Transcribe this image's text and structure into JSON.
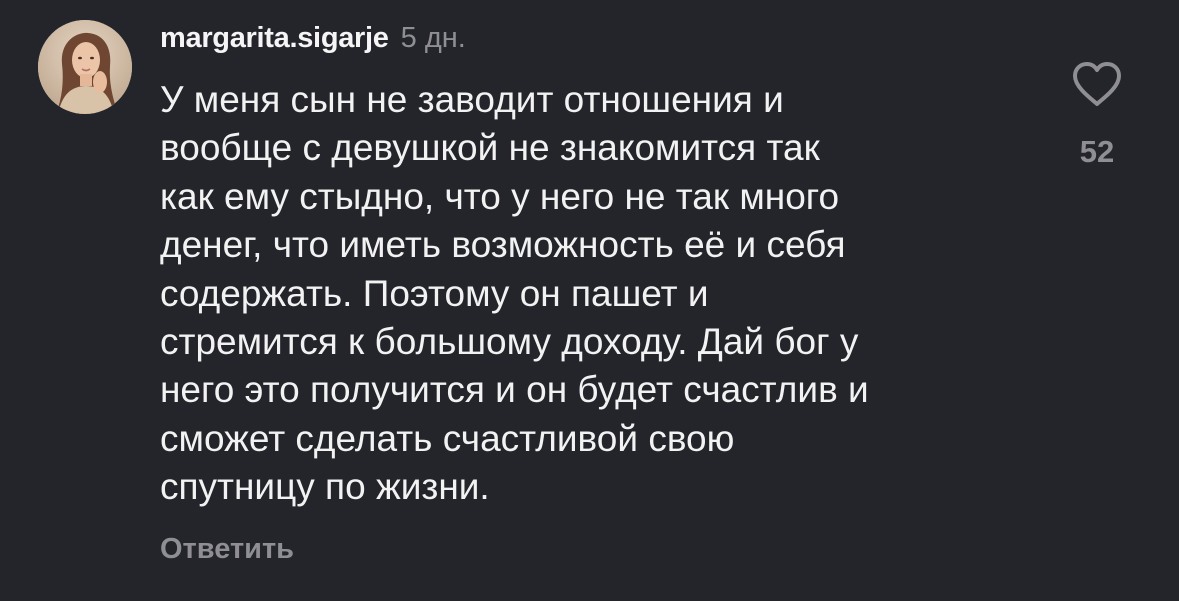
{
  "comment": {
    "username": "margarita.sigarje",
    "time": "5 дн.",
    "text_lines": [
      "У меня сын не заводит отношения и",
      "вообще с девушкой не знакомится так",
      "как ему стыдно, что у него не так много",
      "денег, что иметь возможность её и себя",
      "содержать. Поэтому он пашет и",
      "стремится к большому доходу. Дай бог у",
      "него это получится и он будет счастлив и",
      "сможет сделать счастливой свою",
      "спутницу по жизни."
    ],
    "reply_label": "Ответить",
    "like_count": "52",
    "like_icon": "heart-outline-icon"
  },
  "colors": {
    "background": "#23252b",
    "text": "#f2f2f2",
    "muted": "#8e8e93"
  }
}
